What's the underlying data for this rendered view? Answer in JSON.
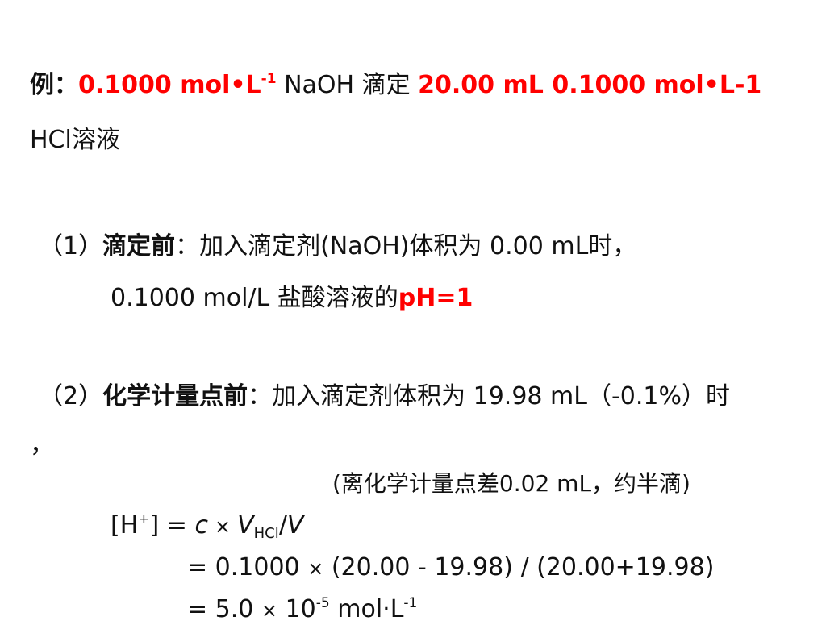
{
  "example": {
    "label": "例：",
    "conc1": "0.1000 mol•L",
    "conc1_exp": "-1",
    "titrant": " NaOH 滴定 ",
    "vol_conc": "20.00 mL 0.1000 mol•L-1",
    "analyte": "HCl溶液"
  },
  "step1": {
    "index": "（1）",
    "title": "滴定前",
    "desc": "：加入滴定剂(NaOH)体积为 0.00 mL时，",
    "detail": "0.1000 mol/L 盐酸溶液的",
    "result": "pH=1"
  },
  "step2": {
    "index": "（2）",
    "title": "化学计量点前",
    "desc": "：加入滴定剂体积为 19.98 mL（-0.1%）时",
    "comma": "，",
    "note": "(离化学计量点差0.02 mL，约半滴)",
    "formula": {
      "lhs_open": "[H",
      "lhs_sup": "+",
      "lhs_close": "]",
      "eq1": " = ",
      "c": "c",
      "times": "×",
      "v1": "V",
      "v1_sub": "HCl",
      "slash": "/",
      "v2": "V",
      "line2_eq": "= 0.1000 ",
      "line2_rest": " (20.00 - 19.98) / (20.00+19.98)",
      "line3_eq": "= 5.0 ",
      "line3_ten": " 10",
      "line3_exp": "-5",
      "line3_unit": " mol·L",
      "line3_unit_exp": "-1"
    }
  }
}
